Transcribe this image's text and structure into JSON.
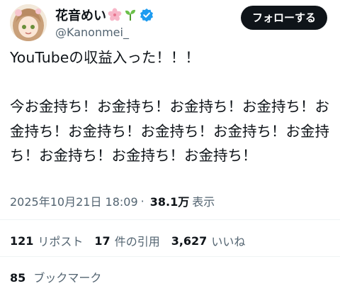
{
  "author": {
    "display_name": "花音めい",
    "handle": "@Kanonmei_",
    "name_emojis": [
      "cherry-blossom-icon",
      "seedling-icon"
    ],
    "verified": true
  },
  "follow_button": {
    "label": "フォローする"
  },
  "tweet": {
    "line1": "YouTubeの収益入った！！！",
    "line2": "今お金持ち！お金持ち！お金持ち！お金持ち！お金持ち！お金持ち！お金持ち！お金持ち！お金持ち！お金持ち！お金持ち！お金持ち！"
  },
  "meta": {
    "timestamp": "2025年10月21日 18:09",
    "separator": "·",
    "views_count": "38.1万",
    "views_label": "表示"
  },
  "stats": {
    "reposts_count": "121",
    "reposts_label": "リポスト",
    "quotes_count": "17",
    "quotes_label": "件の引用",
    "likes_count": "3,627",
    "likes_label": "いいね"
  },
  "bookmarks": {
    "count": "85",
    "label": "ブックマーク"
  },
  "colors": {
    "text_primary": "#0f1419",
    "text_secondary": "#536471",
    "divider": "#eff3f4",
    "verified_blue": "#1d9bf0",
    "follow_bg": "#0f1419"
  }
}
